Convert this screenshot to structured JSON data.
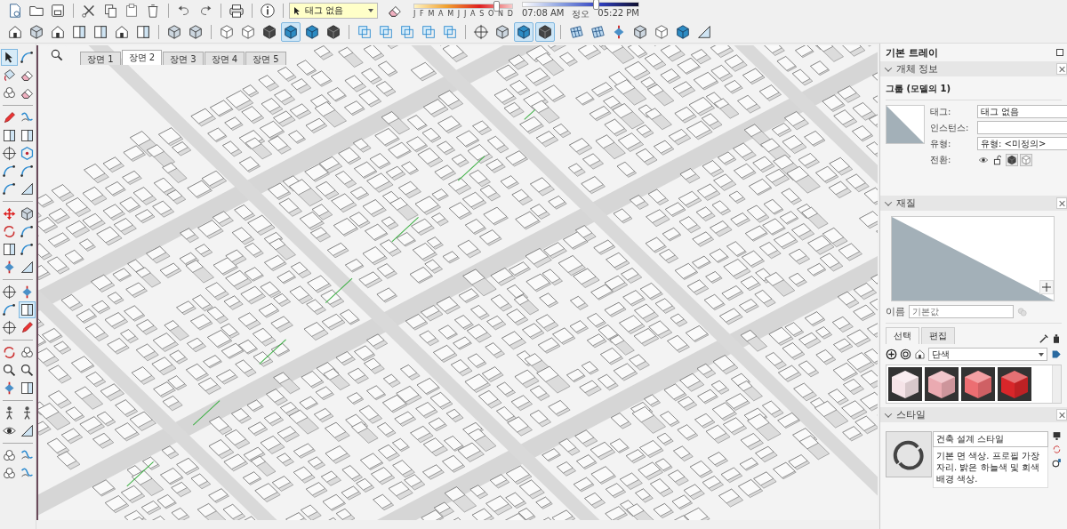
{
  "toolbar": {
    "tag_dropdown": {
      "value": "태그 없음"
    },
    "months": [
      "J",
      "F",
      "M",
      "A",
      "M",
      "J",
      "J",
      "A",
      "S",
      "O",
      "N",
      "D"
    ],
    "month_slider": {
      "level": 0.84
    },
    "time_slider": {
      "level": 0.63
    },
    "time_labels": [
      "07:08 AM",
      "정오",
      "05:22 PM"
    ],
    "face_style_buttons": [
      {
        "selected": false
      },
      {
        "selected": false
      },
      {
        "selected": false
      },
      {
        "selected": false
      },
      {
        "selected": false
      },
      {
        "selected": true
      },
      {
        "selected": false
      },
      {
        "selected": false
      }
    ],
    "camera_buttons": [
      {
        "selected": false
      },
      {
        "selected": false
      },
      {
        "selected": true
      },
      {
        "selected": true
      }
    ]
  },
  "tool_palette": [
    {
      "selected": true
    },
    {
      "selected": false
    },
    {
      "selected": false
    },
    {
      "selected": false
    },
    {
      "selected": false
    },
    {
      "selected": false
    },
    {
      "selected": false
    },
    {
      "selected": false
    },
    {
      "selected": false
    },
    {
      "selected": false
    },
    {
      "selected": false
    },
    {
      "selected": false
    },
    {
      "selected": false
    },
    {
      "selected": false
    },
    {
      "selected": false
    },
    {
      "selected": false
    },
    {
      "selected": false
    },
    {
      "selected": false
    },
    {
      "selected": false
    },
    {
      "selected": false
    },
    {
      "selected": false
    },
    {
      "selected": false
    },
    {
      "selected": false
    },
    {
      "selected": false
    },
    {
      "selected": false
    },
    {
      "selected": false
    },
    {
      "selected": false
    },
    {
      "selected": true
    },
    {
      "selected": false
    },
    {
      "selected": false
    },
    {
      "selected": false
    },
    {
      "selected": false
    },
    {
      "selected": false
    },
    {
      "selected": false
    },
    {
      "selected": false
    },
    {
      "selected": false
    },
    {
      "selected": false
    },
    {
      "selected": false
    },
    {
      "selected": false
    },
    {
      "selected": false
    },
    {
      "selected": false
    },
    {
      "selected": false
    },
    {
      "selected": false
    },
    {
      "selected": false
    }
  ],
  "scene_tabs": [
    {
      "label": "장면 1",
      "selected": false
    },
    {
      "label": "장면 2",
      "selected": true
    },
    {
      "label": "장면 3",
      "selected": false
    },
    {
      "label": "장면 4",
      "selected": false
    },
    {
      "label": "장면 5",
      "selected": false
    }
  ],
  "tray": {
    "title": "기본 트레이",
    "entity_info": {
      "title": "개체 정보",
      "expanded": true,
      "heading": "그룹 (모델의 1)",
      "fields": [
        {
          "label": "태그:",
          "kind": "dropdown",
          "value": "태그 없음"
        },
        {
          "label": "인스턴스:",
          "kind": "input"
        },
        {
          "label": "유형:",
          "kind": "dropdown",
          "value": "유형: <미정의>"
        },
        {
          "label": "전환:",
          "kind": "toggles"
        }
      ]
    },
    "materials": {
      "title": "재질",
      "expanded": true,
      "name_label": "이름",
      "name_placeholder": "기본값",
      "tabs": [
        {
          "label": "선택",
          "selected": true
        },
        {
          "label": "편집",
          "selected": false
        }
      ],
      "library": "단색",
      "swatches": [
        {
          "color": "#f6e4e8"
        },
        {
          "color": "#eaaab1"
        },
        {
          "color": "#ec6e72"
        },
        {
          "color": "#d8262a"
        }
      ]
    },
    "styles": {
      "title": "스타일",
      "expanded": true,
      "name": "건축 설계 스타일",
      "description": "기본 면 색상. 프로필 가장자리. 밝은 하늘색 및 회색 배경 색상."
    }
  }
}
